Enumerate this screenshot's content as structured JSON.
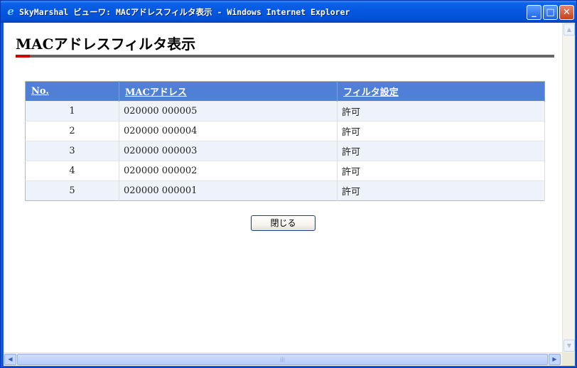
{
  "window": {
    "title": "SkyMarshal ビューワ: MACアドレスフィルタ表示 - Windows Internet Explorer",
    "icon": "ie-icon",
    "minimize_label": "_",
    "maximize_label": "□",
    "close_label": "✕"
  },
  "page": {
    "title": "MACアドレスフィルタ表示"
  },
  "table": {
    "headers": {
      "no": "No.",
      "mac": "MACアドレス",
      "filter": "フィルタ設定"
    },
    "rows": [
      {
        "no": "1",
        "mac": "020000 000005",
        "filter": "許可"
      },
      {
        "no": "2",
        "mac": "020000 000004",
        "filter": "許可"
      },
      {
        "no": "3",
        "mac": "020000 000003",
        "filter": "許可"
      },
      {
        "no": "4",
        "mac": "020000 000002",
        "filter": "許可"
      },
      {
        "no": "5",
        "mac": "020000 000001",
        "filter": "許可"
      }
    ]
  },
  "buttons": {
    "close_label": "閉じる"
  },
  "colors": {
    "header_bg": "#4f7fd6",
    "accent_red": "#cc0000",
    "rule_gray": "#666666",
    "row_alt": "#eef2fa"
  }
}
